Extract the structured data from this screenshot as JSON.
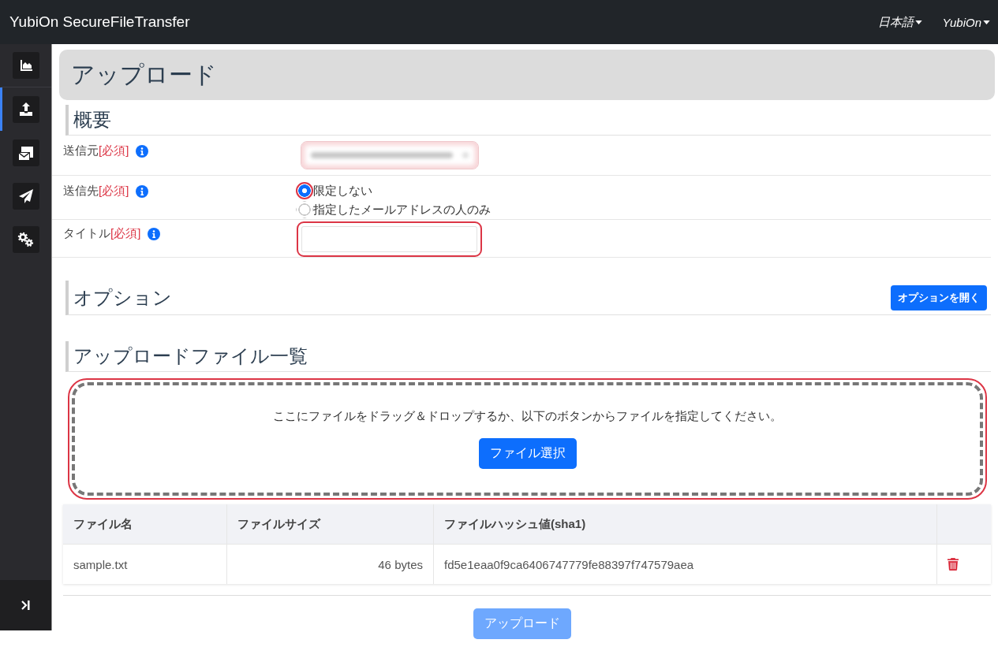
{
  "navbar": {
    "brand": "YubiOn SecureFileTransfer",
    "menus": [
      {
        "label": "日本語"
      },
      {
        "label": "YubiOn"
      }
    ]
  },
  "sidebar": {
    "items": [
      {
        "kind": "chart",
        "selected": false
      },
      {
        "kind": "upload",
        "selected": true
      },
      {
        "kind": "mailbox",
        "selected": false
      },
      {
        "kind": "send",
        "selected": false
      },
      {
        "kind": "settings",
        "selected": false
      }
    ]
  },
  "page_title": "アップロード",
  "overview": {
    "heading": "概要",
    "fields": [
      {
        "kind": "select",
        "label": "送信元",
        "required_mark": "[必須]",
        "obscured": true,
        "invalid": true
      },
      {
        "kind": "radio",
        "label": "送信先",
        "required_mark": "[必須]",
        "options": [
          {
            "label": "限定しない",
            "selected": true,
            "invalid": true
          },
          {
            "label": "指定したメールアドレスの人のみ",
            "selected": false,
            "invalid": false
          }
        ]
      },
      {
        "kind": "text",
        "label": "タイトル",
        "required_mark": "[必須]",
        "invalid": true
      }
    ]
  },
  "options": {
    "heading": "オプション",
    "button": "オプションを開く"
  },
  "file_list": {
    "heading": "アップロードファイル一覧",
    "dropzone": {
      "message": "ここにファイルをドラッグ＆ドロップするか、以下のボタンからファイルを指定してください。",
      "button": "ファイル選択",
      "invalid": true
    },
    "table": {
      "columns": [
        "ファイル名",
        "ファイルサイズ",
        "ファイルハッシュ値(sha1)"
      ],
      "rows": [
        [
          "sample.txt",
          "46 bytes",
          "fd5e1eaa0f9ca6406747779fe88397f747579aea"
        ]
      ]
    }
  },
  "upload_button": {
    "label": "アップロード",
    "disabled": true
  }
}
